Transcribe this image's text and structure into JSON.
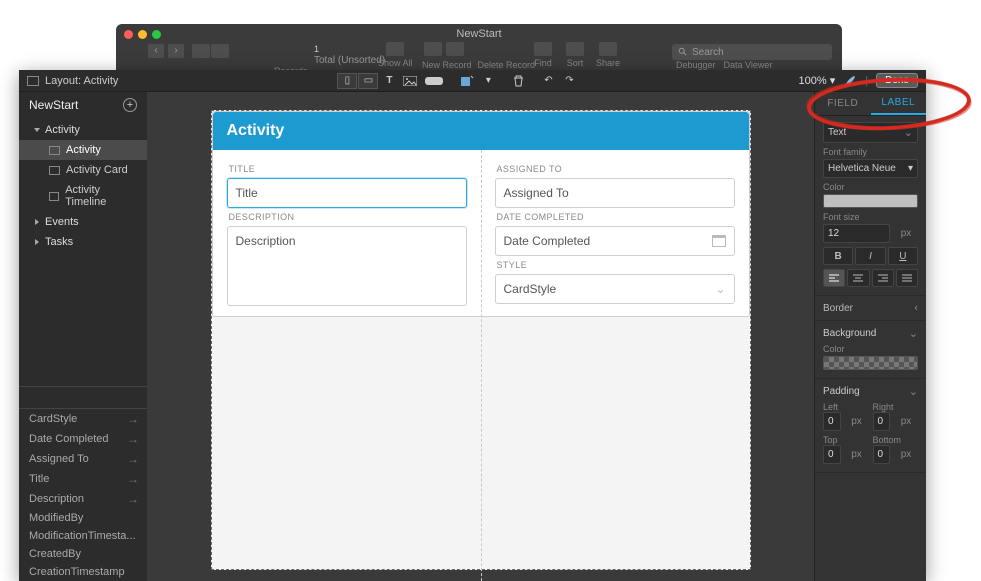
{
  "mac": {
    "title": "NewStart",
    "totalCount": "1",
    "totalLabel": "Total (Unsorted)",
    "recordsLabel": "Records",
    "showAll": "Show All",
    "newRecord": "New Record",
    "deleteRecord": "Delete Record",
    "find": "Find",
    "sort": "Sort",
    "share": "Share",
    "debugger": "Debugger",
    "dataViewer": "Data Viewer",
    "searchPlaceholder": "Search"
  },
  "toolbar": {
    "layoutLabel": "Layout: Activity",
    "zoom": "100%",
    "done": "Done"
  },
  "sidebar": {
    "fileName": "NewStart",
    "groups": [
      {
        "label": "Activity",
        "expanded": true,
        "items": [
          "Activity",
          "Activity Card",
          "Activity Timeline"
        ],
        "active": "Activity"
      },
      {
        "label": "Events",
        "expanded": false
      },
      {
        "label": "Tasks",
        "expanded": false
      }
    ],
    "fields": [
      "CardStyle",
      "Date Completed",
      "Assigned To",
      "Title",
      "Description",
      "ModifiedBy",
      "ModificationTimesta...",
      "CreatedBy",
      "CreationTimestamp"
    ]
  },
  "canvas": {
    "cardTitle": "Activity",
    "left": {
      "titleLabel": "TITLE",
      "titleValue": "Title",
      "descLabel": "DESCRIPTION",
      "descValue": "Description"
    },
    "right": {
      "assignedLabel": "ASSIGNED TO",
      "assignedValue": "Assigned To",
      "dateLabel": "DATE COMPLETED",
      "dateValue": "Date Completed",
      "styleLabel": "STYLE",
      "styleValue": "CardStyle"
    }
  },
  "inspector": {
    "tabs": {
      "field": "FIELD",
      "label": "LABEL"
    },
    "text": {
      "section": "Text",
      "fontFamilyLabel": "Font family",
      "fontFamily": "Helvetica Neue",
      "colorLabel": "Color",
      "fontSizeLabel": "Font size",
      "fontSize": "12",
      "fontSizeUnit": "px"
    },
    "border": {
      "section": "Border"
    },
    "background": {
      "section": "Background",
      "colorLabel": "Color"
    },
    "padding": {
      "section": "Padding",
      "leftLabel": "Left",
      "rightLabel": "Right",
      "topLabel": "Top",
      "bottomLabel": "Bottom",
      "left": "0",
      "right": "0",
      "top": "0",
      "bottom": "0",
      "unit": "px"
    }
  }
}
